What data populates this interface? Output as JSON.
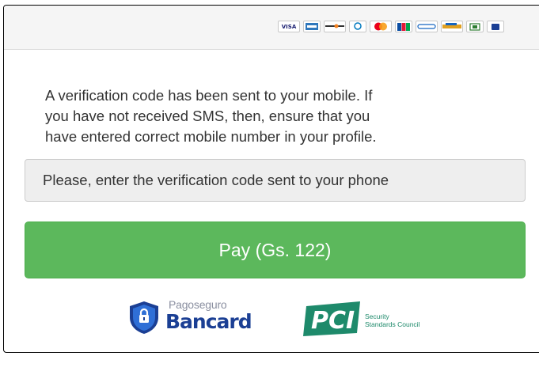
{
  "header": {
    "cards": [
      {
        "name": "visa-card-icon",
        "label": "VISA",
        "color": "#1a1f71"
      },
      {
        "name": "amex-card-icon",
        "label": "",
        "color": "#2e77bc"
      },
      {
        "name": "discover-card-icon",
        "label": "",
        "color": "#f58220"
      },
      {
        "name": "diners-card-icon",
        "label": "",
        "color": "#0079be"
      },
      {
        "name": "mastercard-card-icon",
        "label": "",
        "color": "#eb001b"
      },
      {
        "name": "jcb-card-icon",
        "label": "",
        "color": "#0b4ea2"
      },
      {
        "name": "cabal-card-icon",
        "label": "",
        "color": "#1565c0"
      },
      {
        "name": "credicard-card-icon",
        "label": "",
        "color": "#e0a020"
      },
      {
        "name": "panal-card-icon",
        "label": "",
        "color": "#2e7d32"
      },
      {
        "name": "bancard-card-icon",
        "label": "",
        "color": "#1b3f94"
      }
    ]
  },
  "message": {
    "line1": "A verification code has been sent to your mobile. If",
    "line2": "you have not received SMS, then, ensure that you",
    "line3": "have entered correct mobile number in your profile."
  },
  "code_input": {
    "placeholder": "Please, enter the verification code sent to your phone",
    "value": ""
  },
  "pay_button": {
    "label": "Pay (Gs. 122)"
  },
  "footer": {
    "bancard": {
      "pago": "Pagoseguro",
      "name": "Bancard"
    },
    "pci": {
      "mark": "PCI",
      "line1": "Security",
      "line2": "Standards Council"
    }
  },
  "colors": {
    "pay_button": "#5cb85c",
    "bancard_blue": "#1b3f94",
    "pci_green": "#1e8a6b"
  }
}
